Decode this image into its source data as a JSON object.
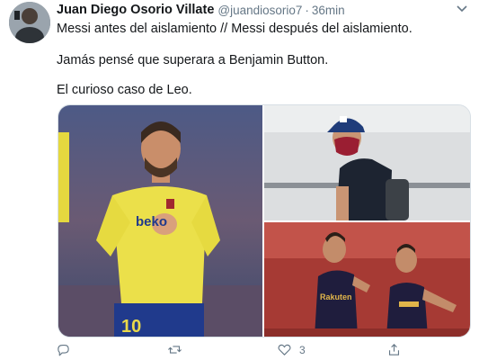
{
  "tweet": {
    "author_name": "Juan Diego Osorio Villate",
    "handle": "@juandiosorio7",
    "separator": "·",
    "time": "36min",
    "lines": [
      "Messi antes del aislamiento // Messi después del aislamiento.",
      "Jamás pensé que superara a Benjamin Button.",
      "El curioso caso de Leo."
    ],
    "media": {
      "jersey_text_left": "beko",
      "jersey_number": "10",
      "jersey_text_right": "Rakuten"
    }
  },
  "actions": {
    "like_count": "3"
  },
  "colors": {
    "text": "#14171a",
    "secondary": "#657786",
    "border": "#d7dfe5"
  }
}
